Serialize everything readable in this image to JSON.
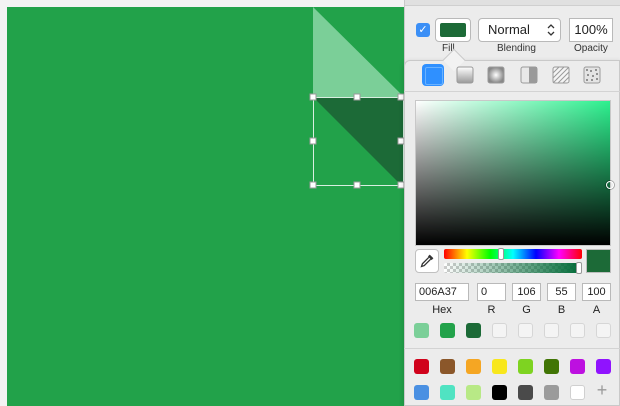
{
  "fill": {
    "enabled": true,
    "color": "#1c6a37",
    "blending_value": "Normal",
    "opacity_value": "100%",
    "labels": {
      "fill": "Fill",
      "blending": "Blending",
      "opacity": "Opacity"
    }
  },
  "color_picker": {
    "fill_types": [
      "solid-fill",
      "linear-gradient",
      "radial-gradient",
      "angular-gradient",
      "pattern-fill",
      "noise-fill"
    ],
    "selected_fill_type": "solid-fill",
    "saturation_field_hue_color": "#2cf08e",
    "hue_position": 0.41,
    "alpha_position": 1.0,
    "current_color": "#1c6a37",
    "hex": "006A37",
    "r": "0",
    "g": "106",
    "b": "55",
    "a": "100",
    "labels": {
      "hex": "Hex",
      "r": "R",
      "g": "G",
      "b": "B",
      "a": "A"
    }
  },
  "document_colors": [
    "#7bcf98",
    "#22a24a",
    "#1c6a37",
    "",
    "",
    "",
    "",
    ""
  ],
  "global_colors": [
    "#d0021b",
    "#8b572a",
    "#f5a623",
    "#f8e71c",
    "#7ed321",
    "#417505",
    "#bd10e0",
    "#9013fe",
    "#4a90e2",
    "#50e3c2",
    "#b8e986",
    "#000000",
    "#4a4a4a",
    "#9b9b9b",
    "#ffffff"
  ],
  "canvas": {
    "background": "#22a24a",
    "fold_light": "#7bcf98",
    "fold_dark": "#1c6a37"
  }
}
